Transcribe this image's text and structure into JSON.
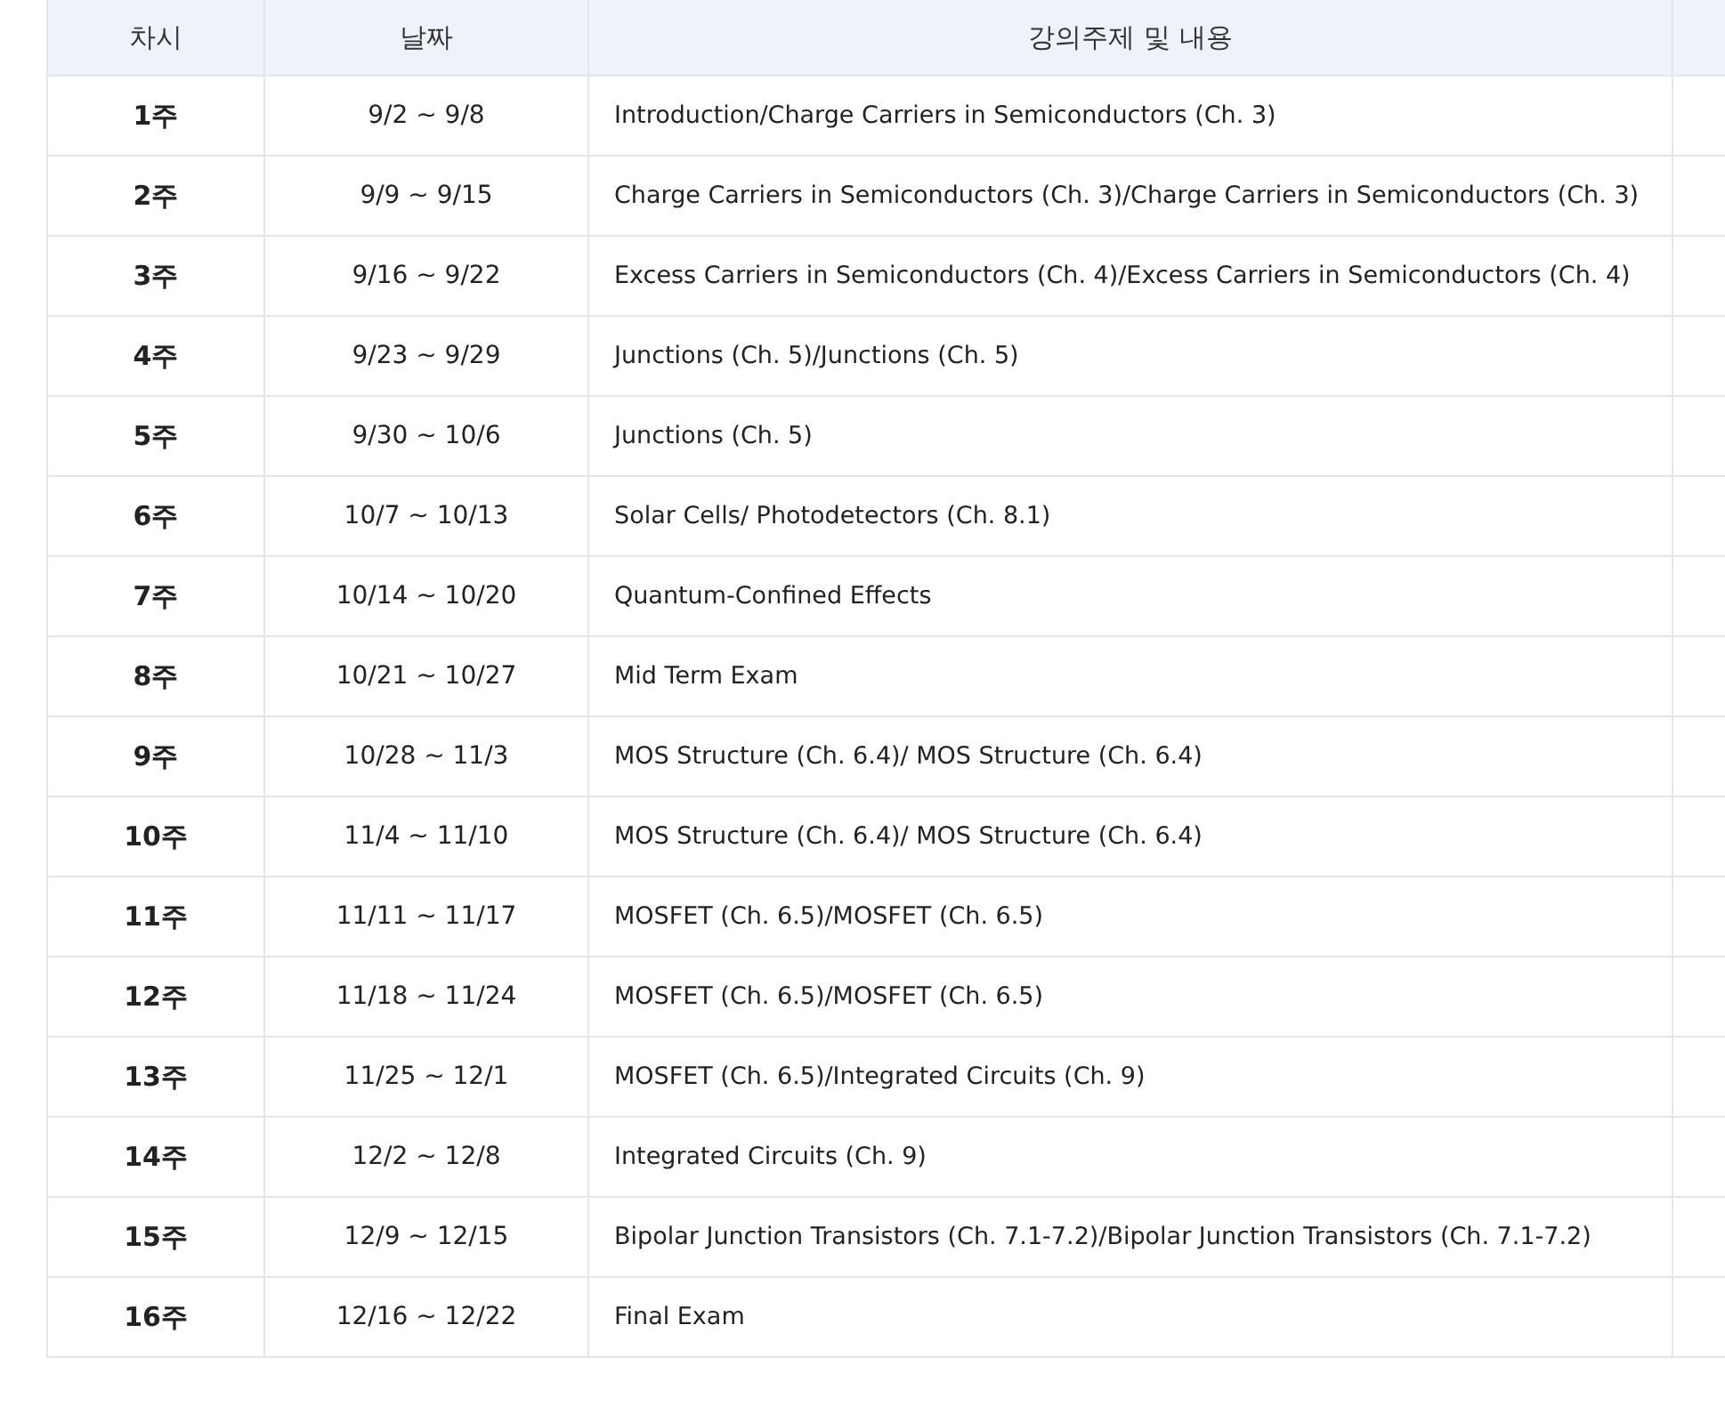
{
  "table": {
    "columns": [
      "차시",
      "날짜",
      "강의주제 및 내용"
    ],
    "rows": [
      {
        "week": "1주",
        "dates": "9/2 ~ 9/8",
        "topic": "Introduction/Charge Carriers in Semiconductors (Ch. 3)"
      },
      {
        "week": "2주",
        "dates": "9/9 ~ 9/15",
        "topic": "Charge Carriers in Semiconductors (Ch. 3)/Charge Carriers in Semiconductors (Ch. 3)"
      },
      {
        "week": "3주",
        "dates": "9/16 ~ 9/22",
        "topic": "Excess Carriers in Semiconductors (Ch. 4)/Excess Carriers in Semiconductors (Ch. 4)"
      },
      {
        "week": "4주",
        "dates": "9/23 ~ 9/29",
        "topic": "Junctions (Ch. 5)/Junctions (Ch. 5)"
      },
      {
        "week": "5주",
        "dates": "9/30 ~ 10/6",
        "topic": "Junctions (Ch. 5)"
      },
      {
        "week": "6주",
        "dates": "10/7 ~ 10/13",
        "topic": "Solar Cells/ Photodetectors (Ch. 8.1)"
      },
      {
        "week": "7주",
        "dates": "10/14 ~ 10/20",
        "topic": "Quantum-Confined Effects"
      },
      {
        "week": "8주",
        "dates": "10/21 ~ 10/27",
        "topic": "Mid Term Exam"
      },
      {
        "week": "9주",
        "dates": "10/28 ~ 11/3",
        "topic": "MOS Structure (Ch. 6.4)/ MOS Structure (Ch. 6.4)"
      },
      {
        "week": "10주",
        "dates": "11/4 ~ 11/10",
        "topic": "MOS Structure (Ch. 6.4)/ MOS Structure (Ch. 6.4)"
      },
      {
        "week": "11주",
        "dates": "11/11 ~ 11/17",
        "topic": "MOSFET (Ch. 6.5)/MOSFET (Ch. 6.5)"
      },
      {
        "week": "12주",
        "dates": "11/18 ~ 11/24",
        "topic": "MOSFET (Ch. 6.5)/MOSFET (Ch. 6.5)"
      },
      {
        "week": "13주",
        "dates": "11/25 ~ 12/1",
        "topic": "MOSFET (Ch. 6.5)/Integrated Circuits (Ch. 9)"
      },
      {
        "week": "14주",
        "dates": "12/2 ~ 12/8",
        "topic": "Integrated Circuits (Ch. 9)"
      },
      {
        "week": "15주",
        "dates": "12/9 ~ 12/15",
        "topic": "Bipolar Junction Transistors (Ch. 7.1-7.2)/Bipolar Junction Transistors (Ch. 7.1-7.2)"
      },
      {
        "week": "16주",
        "dates": "12/16 ~ 12/22",
        "topic": "Final Exam"
      }
    ]
  }
}
